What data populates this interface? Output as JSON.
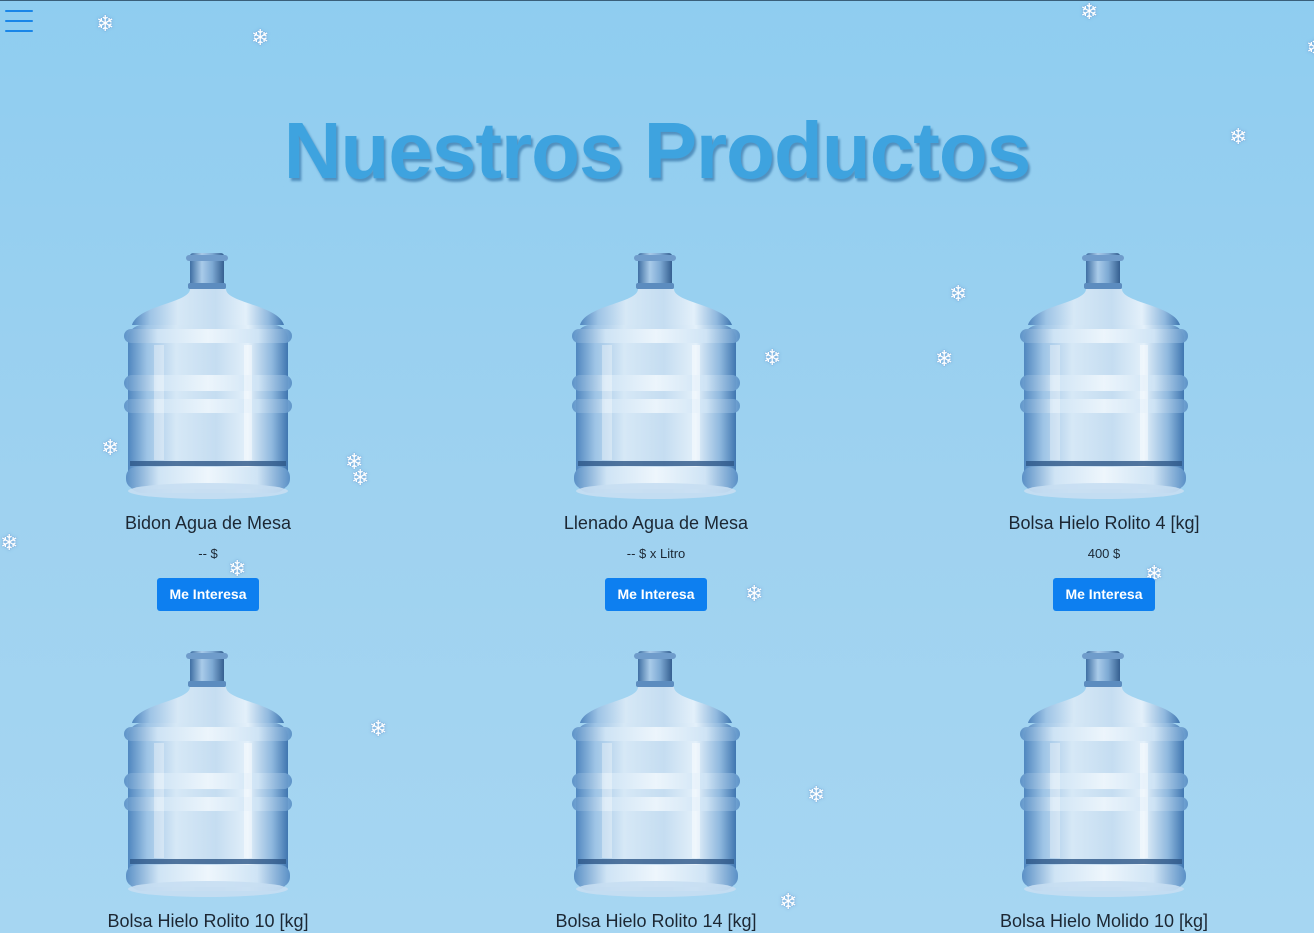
{
  "header": {
    "menu_icon": "hamburger-menu-icon",
    "title": "Nuestros Productos"
  },
  "decorations": {
    "snowflake_glyph": "❄"
  },
  "products": [
    {
      "name": "Bidon Agua de Mesa",
      "price": "-- $",
      "button": "Me Interesa",
      "image": "water-jug-image"
    },
    {
      "name": "Llenado Agua de Mesa",
      "price": "-- $ x Litro",
      "button": "Me Interesa",
      "image": "water-jug-image"
    },
    {
      "name": "Bolsa Hielo Rolito 4 [kg]",
      "price": "400 $",
      "button": "Me Interesa",
      "image": "water-jug-image"
    },
    {
      "name": "Bolsa Hielo Rolito 10 [kg]",
      "image": "water-jug-image"
    },
    {
      "name": "Bolsa Hielo Rolito 14 [kg]",
      "image": "water-jug-image"
    },
    {
      "name": "Bolsa Hielo Molido 10 [kg]",
      "image": "water-jug-image"
    }
  ],
  "colors": {
    "background": "#9dd1f0",
    "title": "#3ea3df",
    "button": "#0d7ff0",
    "menu_icon": "#1a86e8"
  }
}
